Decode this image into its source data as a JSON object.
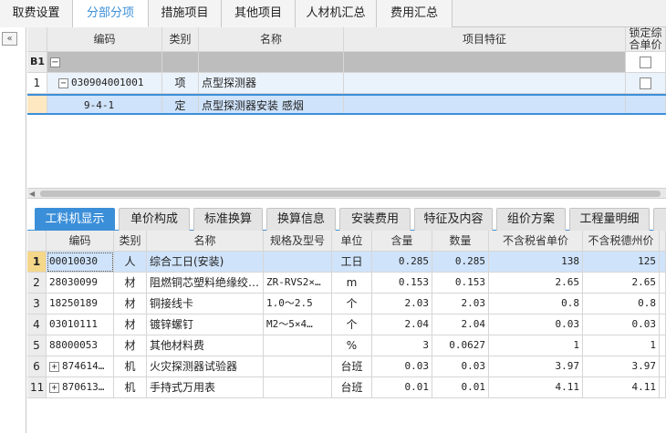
{
  "top_tabs": [
    {
      "label": "取费设置",
      "active": false
    },
    {
      "label": "分部分项",
      "active": true
    },
    {
      "label": "措施项目",
      "active": false
    },
    {
      "label": "其他项目",
      "active": false
    },
    {
      "label": "人材机汇总",
      "active": false
    },
    {
      "label": "费用汇总",
      "active": false
    }
  ],
  "left_strip": {
    "collapse_glyph": "«"
  },
  "upper_grid": {
    "headers": {
      "code": "编码",
      "category": "类别",
      "name": "名称",
      "feature": "项目特征",
      "lock": "锁定综合单价"
    },
    "rows": [
      {
        "rownum": "B1",
        "tree": "−",
        "code": "",
        "category": "",
        "name": "",
        "feature": ""
      },
      {
        "rownum": "1",
        "tree": "−",
        "code": "030904001001",
        "category": "项",
        "name": "点型探测器",
        "feature": ""
      },
      {
        "rownum": "",
        "tree": "",
        "code": "9-4-1",
        "category": "定",
        "name": "点型探测器安装 感烟",
        "feature": ""
      }
    ]
  },
  "bottom_tabs": [
    {
      "label": "工料机显示",
      "active": true
    },
    {
      "label": "单价构成",
      "active": false
    },
    {
      "label": "标准换算",
      "active": false
    },
    {
      "label": "换算信息",
      "active": false
    },
    {
      "label": "安装费用",
      "active": false
    },
    {
      "label": "特征及内容",
      "active": false
    },
    {
      "label": "组价方案",
      "active": false
    },
    {
      "label": "工程量明细",
      "active": false
    }
  ],
  "lower_grid": {
    "headers": {
      "code": "编码",
      "category": "类别",
      "name": "名称",
      "spec": "规格及型号",
      "unit": "单位",
      "content": "含量",
      "quantity": "数量",
      "price_prov": "不含税省单价",
      "price_dz": "不含税德州价"
    },
    "rows": [
      {
        "rownum": "1",
        "expander": "",
        "code": "00010030",
        "category": "人",
        "name": "综合工日(安装)",
        "spec": "",
        "unit": "工日",
        "content": "0.285",
        "quantity": "0.285",
        "price_prov": "138",
        "price_dz": "125"
      },
      {
        "rownum": "2",
        "expander": "",
        "code": "28030099",
        "category": "材",
        "name": "阻燃铜芯塑料绝缘绞…",
        "spec": "ZR-RVS2×…",
        "unit": "m",
        "content": "0.153",
        "quantity": "0.153",
        "price_prov": "2.65",
        "price_dz": "2.65"
      },
      {
        "rownum": "3",
        "expander": "",
        "code": "18250189",
        "category": "材",
        "name": "铜接线卡",
        "spec": "1.0～2.5",
        "unit": "个",
        "content": "2.03",
        "quantity": "2.03",
        "price_prov": "0.8",
        "price_dz": "0.8"
      },
      {
        "rownum": "4",
        "expander": "",
        "code": "03010111",
        "category": "材",
        "name": "镀锌螺钉",
        "spec": "M2～5×4…",
        "unit": "个",
        "content": "2.04",
        "quantity": "2.04",
        "price_prov": "0.03",
        "price_dz": "0.03"
      },
      {
        "rownum": "5",
        "expander": "",
        "code": "88000053",
        "category": "材",
        "name": "其他材料费",
        "spec": "",
        "unit": "%",
        "content": "3",
        "quantity": "0.0627",
        "price_prov": "1",
        "price_dz": "1"
      },
      {
        "rownum": "6",
        "expander": "+",
        "code": "874614…",
        "category": "机",
        "name": "火灾探测器试验器",
        "spec": "",
        "unit": "台班",
        "content": "0.03",
        "quantity": "0.03",
        "price_prov": "3.97",
        "price_dz": "3.97"
      },
      {
        "rownum": "11",
        "expander": "+",
        "code": "870613…",
        "category": "机",
        "name": "手持式万用表",
        "spec": "",
        "unit": "台班",
        "content": "0.01",
        "quantity": "0.01",
        "price_prov": "4.11",
        "price_dz": "4.11"
      }
    ]
  }
}
